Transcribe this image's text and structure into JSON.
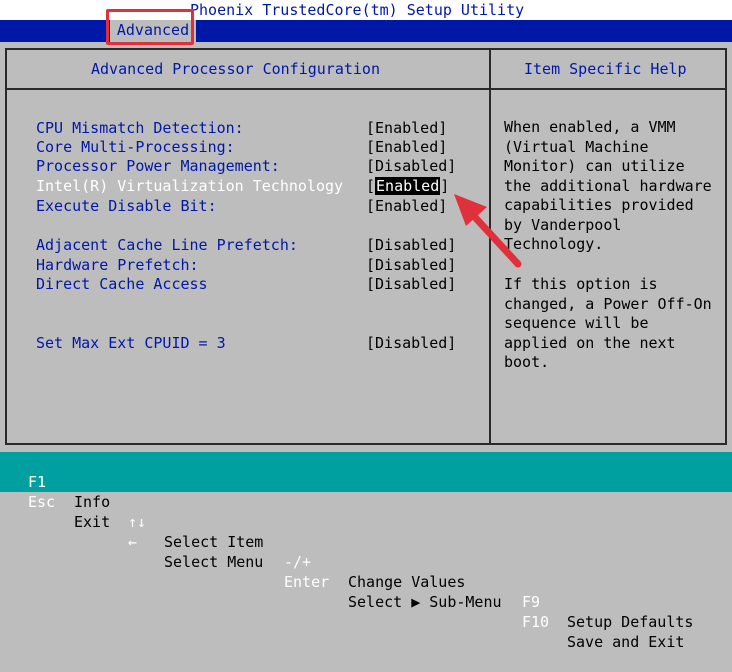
{
  "window": {
    "title": "Phoenix TrustedCore(tm) Setup Utility"
  },
  "menu": {
    "active_tab": "Advanced"
  },
  "panel": {
    "title": "Advanced Processor Configuration",
    "help_title": "Item Specific Help"
  },
  "settings": [
    {
      "label": "CPU Mismatch Detection:",
      "value": "[Enabled]"
    },
    {
      "label": "Core Multi-Processing:",
      "value": "[Enabled]"
    },
    {
      "label": "Processor Power Management:",
      "value": "[Disabled]"
    },
    {
      "label": "Intel(R) Virtualization Technology",
      "value": "[Enabled]",
      "value_open": "[",
      "value_text": "Enabled",
      "value_close": "]",
      "selected": true
    },
    {
      "label": "Execute Disable Bit:",
      "value": "[Enabled]"
    },
    {
      "label": "Adjacent Cache Line Prefetch:",
      "value": "[Disabled]"
    },
    {
      "label": "Hardware Prefetch:",
      "value": "[Disabled]"
    },
    {
      "label": "Direct Cache Access",
      "value": "[Disabled]"
    },
    {
      "label": "Set Max Ext CPUID = 3",
      "value": "[Disabled]"
    }
  ],
  "help": {
    "paragraph1": "When enabled, a VMM\n(Virtual Machine\nMonitor) can utilize\nthe additional hardware\ncapabilities provided\nby Vanderpool\nTechnology.",
    "paragraph2": "If this option is\nchanged, a Power Off-On\nsequence will be\napplied on the next\nboot."
  },
  "footer": {
    "row1": [
      {
        "key": "F1",
        "desc": "Info"
      },
      {
        "key": "↑↓",
        "desc": "Select Item"
      },
      {
        "key": "-/+",
        "desc": "Change Values"
      },
      {
        "key": "F9",
        "desc": "Setup Defaults"
      }
    ],
    "row2": [
      {
        "key": "Esc",
        "desc": "Exit"
      },
      {
        "key": "←",
        "desc": "Select Menu"
      },
      {
        "key": "Enter",
        "desc": "Select ▶ Sub-Menu"
      },
      {
        "key": "F10",
        "desc": "Save and Exit"
      }
    ]
  },
  "colors": {
    "bios_blue": "#0018a8",
    "background_gray": "#bdbdbd",
    "footer_cyan": "#00a0a0",
    "annotation_red": "#e0303c"
  },
  "annotations": {
    "tab_highlight": "red-rectangle",
    "arrow": "red-arrow-pointing-to-selected-value"
  }
}
